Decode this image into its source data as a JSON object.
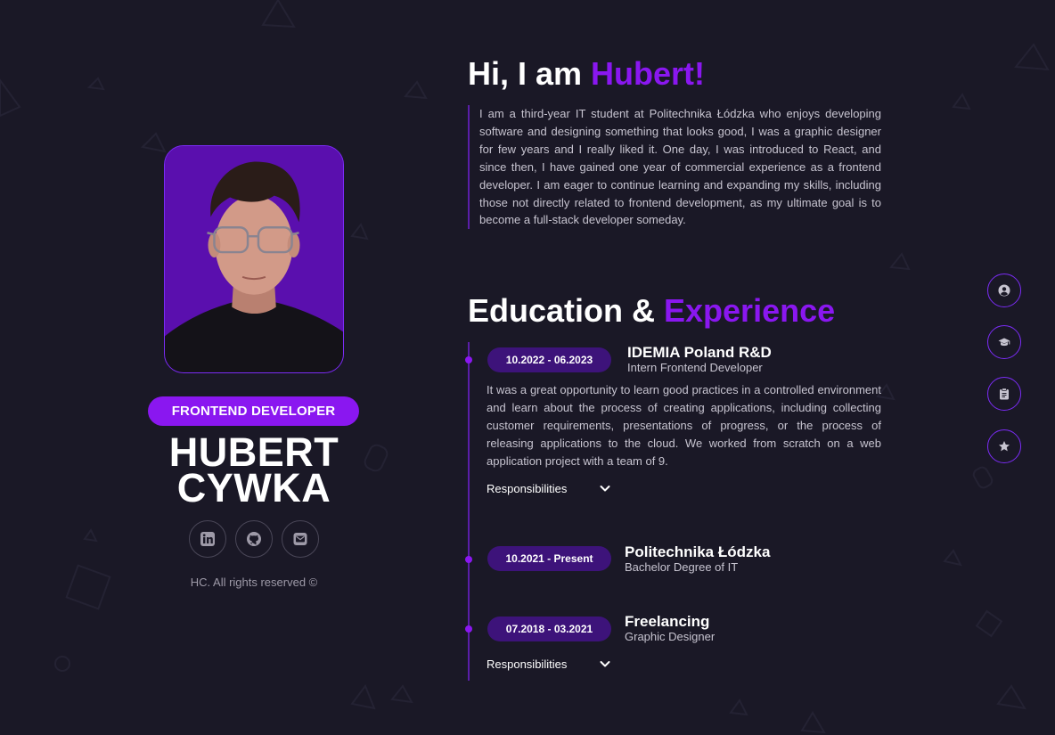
{
  "profile": {
    "role": "FRONTEND DEVELOPER",
    "first_name": "HUBERT",
    "last_name": "CYWKA",
    "copyright": "HC. All rights reserved ©",
    "socials": [
      {
        "icon": "linkedin-icon"
      },
      {
        "icon": "github-icon"
      },
      {
        "icon": "mail-icon"
      }
    ]
  },
  "intro": {
    "greeting": "Hi, I am ",
    "name": "Hubert!",
    "about": "I am a third-year IT student at Politechnika Łódzka who enjoys developing software and designing something that looks good, I was a graphic designer for few years and I really liked it. One day, I was introduced to React, and since then, I have gained one year of commercial experience as a frontend developer. I am eager to continue learning and expanding my skills, including those not directly related to frontend development, as my ultimate goal is to become a full-stack developer someday."
  },
  "experience": {
    "title_main": "Education & ",
    "title_accent": "Experience",
    "entries": [
      {
        "date": "10.2022 - 06.2023",
        "title": "IDEMIA Poland R&D",
        "subtitle": "Intern Frontend Developer",
        "description": "It was a great opportunity to learn good practices in a controlled environment and learn about the process of creating applications, including collecting customer requirements, presentations of progress, or the process of releasing applications to the cloud. We worked from scratch on a web application project with a team of 9.",
        "responsibilities_label": "Responsibilities"
      },
      {
        "date": "10.2021 - Present",
        "title": "Politechnika Łódzka",
        "subtitle": "Bachelor Degree of IT"
      },
      {
        "date": "07.2018 - 03.2021",
        "title": "Freelancing",
        "subtitle": "Graphic Designer",
        "responsibilities_label": "Responsibilities"
      }
    ]
  },
  "side_nav": [
    {
      "icon": "user-icon"
    },
    {
      "icon": "graduation-cap-icon"
    },
    {
      "icon": "clipboard-icon"
    },
    {
      "icon": "star-icon"
    }
  ],
  "colors": {
    "background": "#1a1826",
    "accent": "#8a17f0",
    "pill": "#3d137a"
  }
}
